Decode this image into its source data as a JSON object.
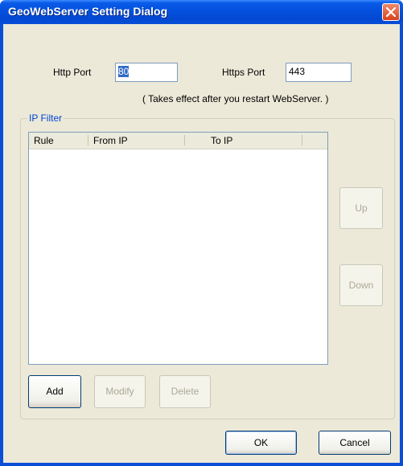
{
  "window": {
    "title": "GeoWebServer Setting Dialog",
    "close_icon": "close-icon",
    "accent": "#0a4fd6",
    "close_color": "#d8421b"
  },
  "ports": {
    "http_label": "Http Port",
    "http_value": "80",
    "https_label": "Https Port",
    "https_value": "443",
    "note": "( Takes effect after you restart WebServer. )"
  },
  "ip_filter": {
    "legend": "IP Filter",
    "legend_color": "#0046d5",
    "columns": [
      "Rule",
      "From IP",
      "To IP"
    ],
    "rows": []
  },
  "buttons": {
    "up": "Up",
    "down": "Down",
    "add": "Add",
    "modify": "Modify",
    "delete": "Delete",
    "ok": "OK",
    "cancel": "Cancel"
  }
}
